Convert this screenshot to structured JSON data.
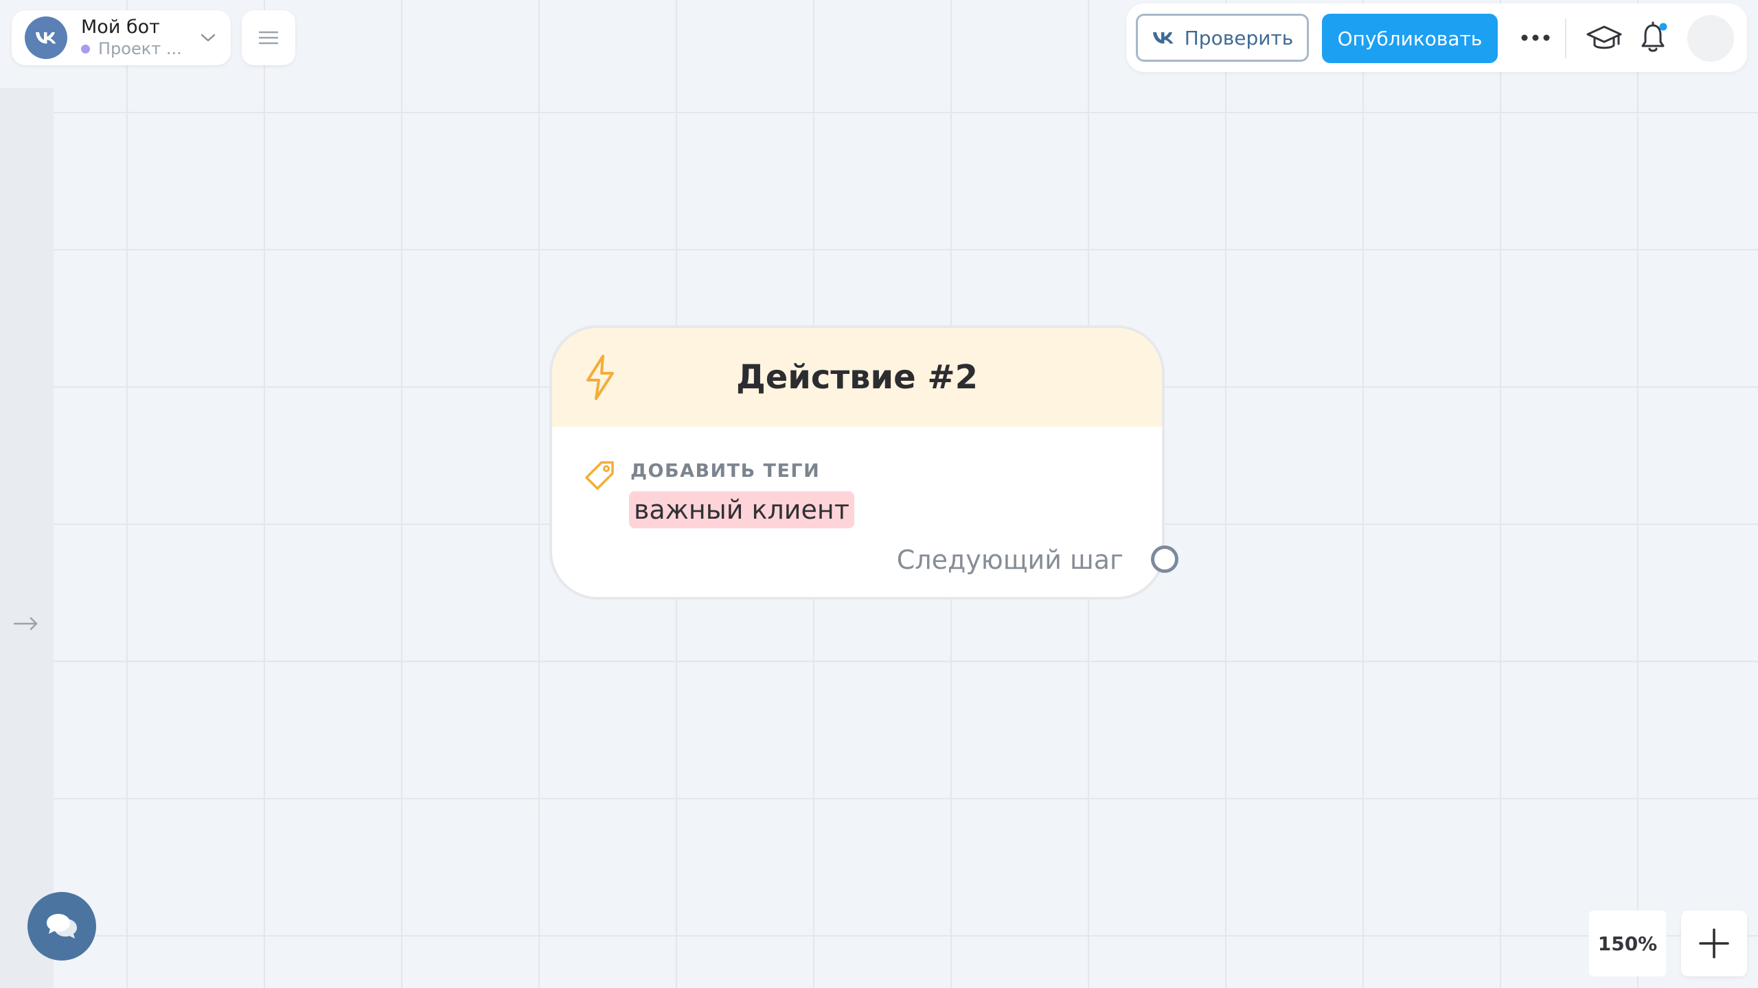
{
  "project": {
    "name": "Мой бот",
    "subtitle": "Проект ..."
  },
  "toolbar": {
    "check_label": "Проверить",
    "publish_label": "Опубликовать"
  },
  "node": {
    "title": "Действие #2",
    "action_label": "ДОБАВИТЬ ТЕГИ",
    "tag": "важный клиент",
    "next_step": "Следующий шаг"
  },
  "zoom": {
    "level": "150%"
  },
  "colors": {
    "canvas_bg": "#f1f4f8",
    "primary": "#1ca0f2",
    "vk_avatar": "#5a80b5",
    "node_header": "#fff4e0",
    "tag_chip": "#ffd4d8",
    "bolt": "#f3ad3a",
    "chat_button": "#4b74a1",
    "status_dot": "#a89cf0",
    "notification_dot": "#1ca0f2"
  },
  "icons": {
    "logo": "vk-logo-icon",
    "project_dropdown": "chevron-down-icon",
    "menu": "hamburger-menu-icon",
    "more": "more-dots-icon",
    "help": "graduation-cap-icon",
    "notifications": "bell-icon",
    "node_type": "lightning-icon",
    "action": "tag-icon",
    "chat": "chat-bubbles-icon",
    "add": "plus-icon",
    "rail": "arrow-right-icon"
  }
}
